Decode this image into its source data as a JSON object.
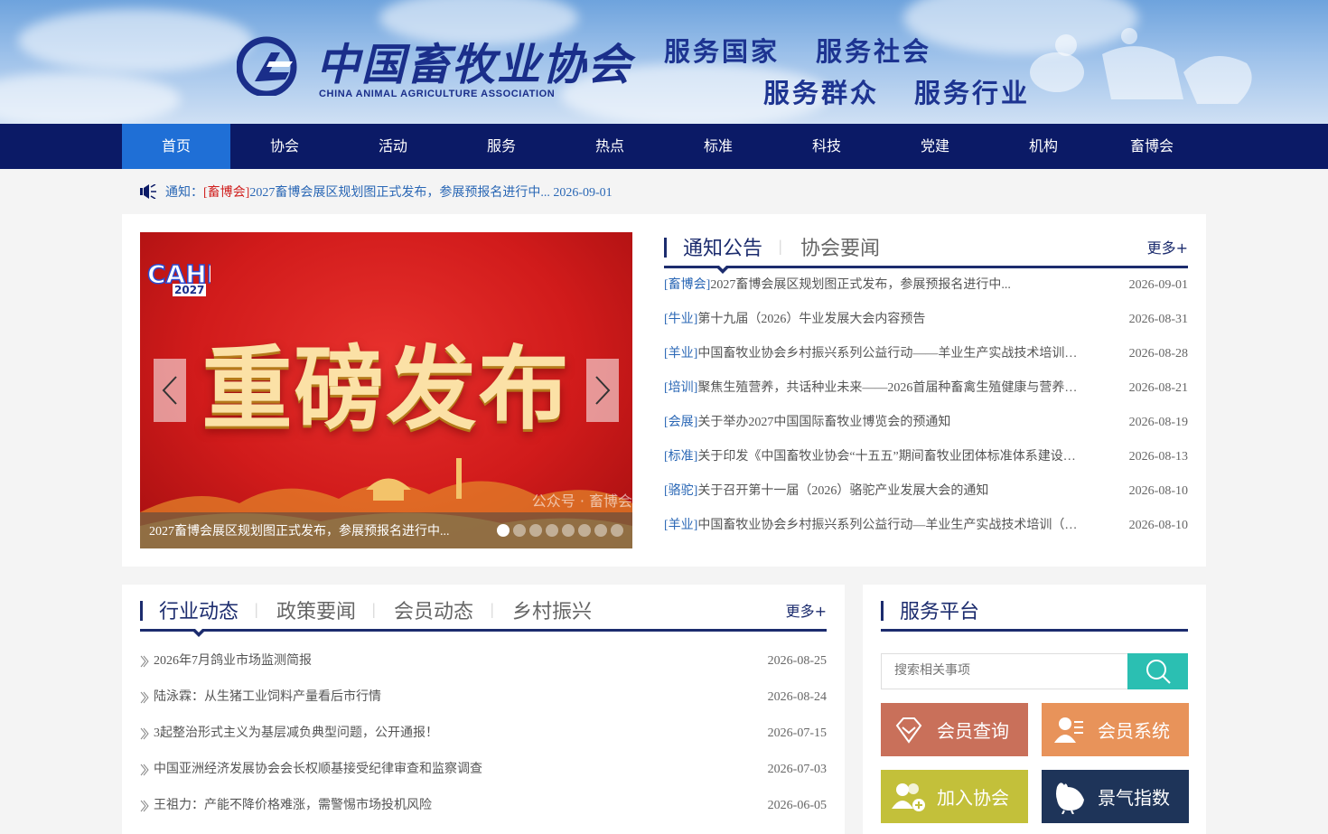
{
  "header": {
    "logo_cn": "中国畜牧业协会",
    "logo_en": "CHINA ANIMAL AGRICULTURE ASSOCIATION",
    "slogans": [
      "服务国家",
      "服务社会",
      "服务群众",
      "服务行业"
    ]
  },
  "nav": {
    "items": [
      "首页",
      "协会",
      "活动",
      "服务",
      "热点",
      "标准",
      "科技",
      "党建",
      "机构",
      "畜博会"
    ],
    "active": "首页"
  },
  "notice": {
    "label": "通知：",
    "tag": "[畜博会]",
    "text": "2027畜博会展区规划图正式发布，参展预报名进行中... 2026-09-01"
  },
  "carousel": {
    "badge_year": "2027",
    "headline": "重磅发布",
    "watermark": "公众号 · 畜博会",
    "caption": "2027畜博会展区规划图正式发布，参展预报名进行中...",
    "slide_count": 8,
    "active_slide": 1
  },
  "notices_panel": {
    "tabs": [
      "通知公告",
      "协会要闻"
    ],
    "more": "更多+",
    "items": [
      {
        "cat": "[畜博会]",
        "title": "2027畜博会展区规划图正式发布，参展预报名进行中...",
        "date": "2026-09-01"
      },
      {
        "cat": "[牛业]",
        "title": "第十九届（2026）牛业发展大会内容预告",
        "date": "2026-08-31"
      },
      {
        "cat": "[羊业]",
        "title": "中国畜牧业协会乡村振兴系列公益行动——羊业生产实战技术培训…",
        "date": "2026-08-28"
      },
      {
        "cat": "[培训]",
        "title": "聚焦生殖营养，共话种业未来——2026首届种畜禽生殖健康与营养…",
        "date": "2026-08-21"
      },
      {
        "cat": "[会展]",
        "title": "关于举办2027中国国际畜牧业博览会的预通知",
        "date": "2026-08-19"
      },
      {
        "cat": "[标准]",
        "title": "关于印发《中国畜牧业协会“十五五”期间畜牧业团体标准体系建设…",
        "date": "2026-08-13"
      },
      {
        "cat": "[骆驼]",
        "title": "关于召开第十一届（2026）骆驼产业发展大会的通知",
        "date": "2026-08-10"
      },
      {
        "cat": "[羊业]",
        "title": "中国畜牧业协会乡村振兴系列公益行动—羊业生产实战技术培训（…",
        "date": "2026-08-10"
      }
    ]
  },
  "industry_panel": {
    "tabs": [
      "行业动态",
      "政策要闻",
      "会员动态",
      "乡村振兴"
    ],
    "more": "更多+",
    "items": [
      {
        "title": "2026年7月鸽业市场监测简报",
        "date": "2026-08-25"
      },
      {
        "title": "陆泳霖：从生猪工业饲料产量看后市行情",
        "date": "2026-08-24"
      },
      {
        "title": "3起整治形式主义为基层减负典型问题，公开通报！",
        "date": "2026-07-15"
      },
      {
        "title": "中国亚洲经济发展协会会长权顺基接受纪律审查和监察调查",
        "date": "2026-07-03"
      },
      {
        "title": "王祖力：产能不降价格难涨，需警惕市场投机风险",
        "date": "2026-06-05"
      }
    ]
  },
  "service_panel": {
    "title": "服务平台",
    "search_placeholder": "搜索相关事项",
    "buttons": [
      {
        "label": "会员查询",
        "icon": "diamond-icon",
        "color": "#c9705a"
      },
      {
        "label": "会员系统",
        "icon": "member-system-icon",
        "color": "#e8935a"
      },
      {
        "label": "加入协会",
        "icon": "add-user-icon",
        "color": "#c3c03a"
      },
      {
        "label": "景气指数",
        "icon": "chicken-icon",
        "color": "#1e3459"
      }
    ]
  },
  "colors": {
    "nav_bg": "#0b1a66",
    "nav_active": "#1f6fd6",
    "accent": "#1c2c6e",
    "search_btn": "#2bbfb2"
  }
}
